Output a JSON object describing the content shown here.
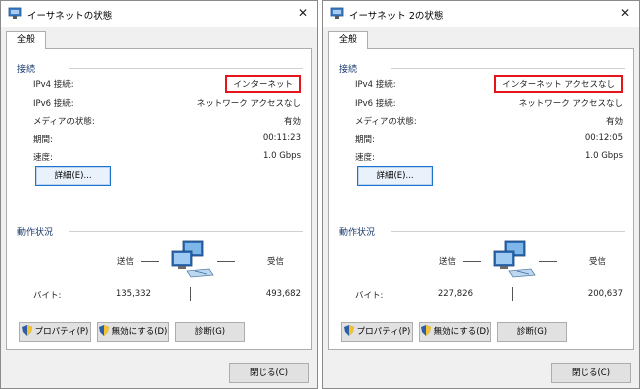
{
  "dialogs": [
    {
      "title": "イーサネットの状態",
      "tab": "全般",
      "connection_header": "接続",
      "rows": [
        {
          "label": "IPv4 接続:",
          "value": "インターネット"
        },
        {
          "label": "IPv6 接続:",
          "value": "ネットワーク アクセスなし"
        },
        {
          "label": "メディアの状態:",
          "value": "有効"
        },
        {
          "label": "期間:",
          "value": "00:11:23"
        },
        {
          "label": "速度:",
          "value": "1.0 Gbps"
        }
      ],
      "details_button": "詳細(E)...",
      "activity_header": "動作状況",
      "sent_label": "送信",
      "received_label": "受信",
      "bytes_label": "バイト:",
      "bytes_sent": "135,332",
      "bytes_received": "493,682",
      "buttons": {
        "properties": "プロパティ(P)",
        "disable": "無効にする(D)",
        "diagnose": "診断(G)",
        "close": "閉じる(C)"
      }
    },
    {
      "title": "イーサネット 2の状態",
      "tab": "全般",
      "connection_header": "接続",
      "rows": [
        {
          "label": "IPv4 接続:",
          "value": "インターネット アクセスなし"
        },
        {
          "label": "IPv6 接続:",
          "value": "ネットワーク アクセスなし"
        },
        {
          "label": "メディアの状態:",
          "value": "有効"
        },
        {
          "label": "期間:",
          "value": "00:12:05"
        },
        {
          "label": "速度:",
          "value": "1.0 Gbps"
        }
      ],
      "details_button": "詳細(E)...",
      "activity_header": "動作状況",
      "sent_label": "送信",
      "received_label": "受信",
      "bytes_label": "バイト:",
      "bytes_sent": "227,826",
      "bytes_received": "200,637",
      "buttons": {
        "properties": "プロパティ(P)",
        "disable": "無効にする(D)",
        "diagnose": "診断(G)",
        "close": "閉じる(C)"
      }
    }
  ],
  "close_glyph": "✕",
  "highlight_color": "#e8141b"
}
